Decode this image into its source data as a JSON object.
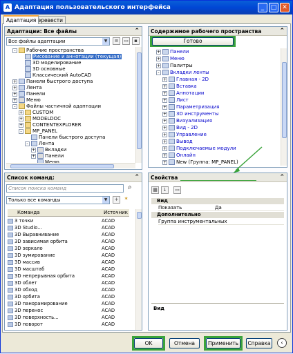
{
  "window": {
    "title": "Адаптация пользовательского интерфейса"
  },
  "tabs": [
    "Адаптация",
    "Перевести"
  ],
  "left_top": {
    "title": "Адаптации: Все файлы",
    "combo": "Все файлы адаптации",
    "tree": [
      {
        "text": "Рабочие пространства",
        "indent": 1,
        "type": "fold",
        "exp": "-"
      },
      {
        "text": "Рисование и аннотации (текущая)",
        "indent": 2,
        "type": "ws",
        "selected": true
      },
      {
        "text": "3D моделирование",
        "indent": 2,
        "type": "ws"
      },
      {
        "text": "3D основные",
        "indent": 2,
        "type": "ws"
      },
      {
        "text": "Классический AutoCAD",
        "indent": 2,
        "type": "ws"
      },
      {
        "text": "Панели быстрого доступа",
        "indent": 1,
        "type": "item",
        "exp": "+"
      },
      {
        "text": "Лента",
        "indent": 1,
        "type": "item",
        "exp": "+"
      },
      {
        "text": "Панели",
        "indent": 1,
        "type": "item",
        "exp": "+"
      },
      {
        "text": "Меню",
        "indent": 1,
        "type": "chk",
        "exp": "+"
      },
      {
        "text": "Файлы частичной адаптации",
        "indent": 1,
        "type": "fold",
        "exp": "-"
      },
      {
        "text": "CUSTOM",
        "indent": 2,
        "type": "fold",
        "exp": "+"
      },
      {
        "text": "MODELDOC",
        "indent": 2,
        "type": "fold",
        "exp": "+"
      },
      {
        "text": "CONTENTEXPLORER",
        "indent": 2,
        "type": "fold",
        "exp": "+"
      },
      {
        "text": "MP_PANEL",
        "indent": 2,
        "type": "fold",
        "exp": "-"
      },
      {
        "text": "Панели быстрого доступа",
        "indent": 3,
        "type": "item"
      },
      {
        "text": "Лента",
        "indent": 3,
        "type": "item",
        "exp": "-"
      },
      {
        "text": "Вкладки",
        "indent": 4,
        "type": "chk",
        "exp": "+"
      },
      {
        "text": "Панели",
        "indent": 4,
        "type": "chk",
        "exp": "+"
      },
      {
        "text": "Меню",
        "indent": 4,
        "type": "item"
      }
    ]
  },
  "commands": {
    "title": "Список команд:",
    "search_placeholder": "Список поиска команд",
    "filter": "Только все команды",
    "col_command": "Команда",
    "col_source": "Источник",
    "rows": [
      [
        "3 точки",
        "ACAD"
      ],
      [
        "3D Studio...",
        "ACAD"
      ],
      [
        "3D Выравнивание",
        "ACAD"
      ],
      [
        "3D зависимая орбита",
        "ACAD"
      ],
      [
        "3D зеркало",
        "ACAD"
      ],
      [
        "3D зумирование",
        "ACAD"
      ],
      [
        "3D массив",
        "ACAD"
      ],
      [
        "3D масштаб",
        "ACAD"
      ],
      [
        "3D непрерывная орбита",
        "ACAD"
      ],
      [
        "3D облет",
        "ACAD"
      ],
      [
        "3D обход",
        "ACAD"
      ],
      [
        "3D орбита",
        "ACAD"
      ],
      [
        "3D панорамирование",
        "ACAD"
      ],
      [
        "3D перенос",
        "ACAD"
      ],
      [
        "3D поверхность...",
        "ACAD"
      ],
      [
        "3D поворот",
        "ACAD"
      ]
    ]
  },
  "workspace": {
    "title": "Содержимое рабочего пространства",
    "done": "Готово",
    "tree": [
      {
        "text": "Панели",
        "indent": 1,
        "exp": "+",
        "blue": true
      },
      {
        "text": "Меню",
        "indent": 1,
        "exp": "+",
        "blue": true
      },
      {
        "text": "Палитры",
        "indent": 1,
        "exp": "+",
        "blue": false
      },
      {
        "text": "Вкладки ленты",
        "indent": 1,
        "exp": "-",
        "blue": true
      },
      {
        "text": "Главная - 2D",
        "indent": 2,
        "exp": "+",
        "blue": true
      },
      {
        "text": "Вставка",
        "indent": 2,
        "exp": "+",
        "blue": true
      },
      {
        "text": "Аннотации",
        "indent": 2,
        "exp": "+",
        "blue": true
      },
      {
        "text": "Лист",
        "indent": 2,
        "exp": "+",
        "blue": true
      },
      {
        "text": "Параметризация",
        "indent": 2,
        "exp": "+",
        "blue": true
      },
      {
        "text": "3D инструменты",
        "indent": 2,
        "exp": "+",
        "blue": true
      },
      {
        "text": "Визуализация",
        "indent": 2,
        "exp": "+",
        "blue": true
      },
      {
        "text": "Вид - 2D",
        "indent": 2,
        "exp": "+",
        "blue": true
      },
      {
        "text": "Управление",
        "indent": 2,
        "exp": "+",
        "blue": true
      },
      {
        "text": "Вывод",
        "indent": 2,
        "exp": "+",
        "blue": true
      },
      {
        "text": "Подключаемые модули",
        "indent": 2,
        "exp": "+",
        "blue": true
      },
      {
        "text": "Онлайн",
        "indent": 2,
        "exp": "+",
        "blue": true
      },
      {
        "text": "New (Группа: MP_PANEL)",
        "indent": 2,
        "exp": "+",
        "blue": false
      }
    ]
  },
  "properties": {
    "title": "Свойства",
    "cat1": "Вид",
    "row1_name": "Показать",
    "row1_val": "Да",
    "cat2": "Дополнительно",
    "row2_name": "Группа инструментальных",
    "footer": "Вид"
  },
  "buttons": {
    "ok": "OK",
    "cancel": "Отмена",
    "apply": "Применить",
    "help": "Справка"
  },
  "colors": {
    "highlight": "#3aa33a",
    "arrow": "#3aa33a"
  }
}
